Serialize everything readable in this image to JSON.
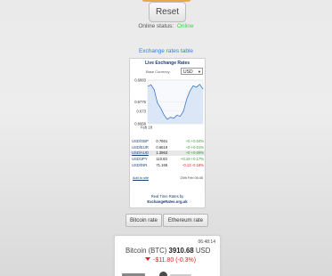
{
  "reset_button": {
    "label": "Reset"
  },
  "status": {
    "label": "Online status:",
    "value": "Online",
    "value_color": "#36d936"
  },
  "exchange_link": {
    "label": "Exchange rates table"
  },
  "widget": {
    "title": "Live Exchange Rates",
    "base_label": "Base Currency:",
    "base_value": "USD",
    "chart_data": {
      "type": "line",
      "title": "",
      "xlabel": "",
      "ylabel": "",
      "y_ticks": [
        "0.6883",
        "0.6775",
        "0.673",
        "0.6668"
      ],
      "x_ticks": [
        "Feb 18"
      ],
      "ylim": [
        0.6668,
        0.6883
      ],
      "series": [
        {
          "values": [
            0.6852,
            0.686,
            0.6835,
            0.677,
            0.6745,
            0.6712,
            0.669,
            0.67,
            0.6695,
            0.671,
            0.6705,
            0.673,
            0.679,
            0.683,
            0.6855,
            0.6848,
            0.6862,
            0.684
          ]
        }
      ],
      "line_color": "#3b77c9",
      "grid": true
    },
    "rates": [
      {
        "pair": "USD/GBP",
        "rate": "0.7661",
        "change": "+0 +0.04%",
        "dir": "pos",
        "underline": false,
        "highlight": false
      },
      {
        "pair": "USD/EUR",
        "rate": "0.6619",
        "change": "+0 +0.01%",
        "dir": "pos",
        "underline": false,
        "highlight": false
      },
      {
        "pair": "USD/AUD",
        "rate": "1.3963",
        "change": "+0 +0.09%",
        "dir": "pos",
        "underline": true,
        "highlight": true
      },
      {
        "pair": "USD/JPY",
        "rate": "110.83",
        "change": "+0.19 +0.17%",
        "dir": "pos",
        "underline": false,
        "highlight": false
      },
      {
        "pair": "USD/INR",
        "rate": "71.165",
        "change": "-0.13 -0.18%",
        "dir": "neg",
        "underline": false,
        "highlight": false
      }
    ],
    "add_to_site": "Add to site",
    "date": "20th Feb 06:45",
    "footer_line1": "Real Time Rates by",
    "footer_line2": "ExchangeRates.org.uk"
  },
  "buttons": {
    "bitcoin": "Bitcoin rate",
    "ethereum": "Ethereum rate"
  },
  "btc_card": {
    "time": "06:48:14",
    "name": "Bitcoin (BTC)",
    "price": "3910.68",
    "currency": "USD",
    "change": "-$11.80 (-0.3%)"
  }
}
